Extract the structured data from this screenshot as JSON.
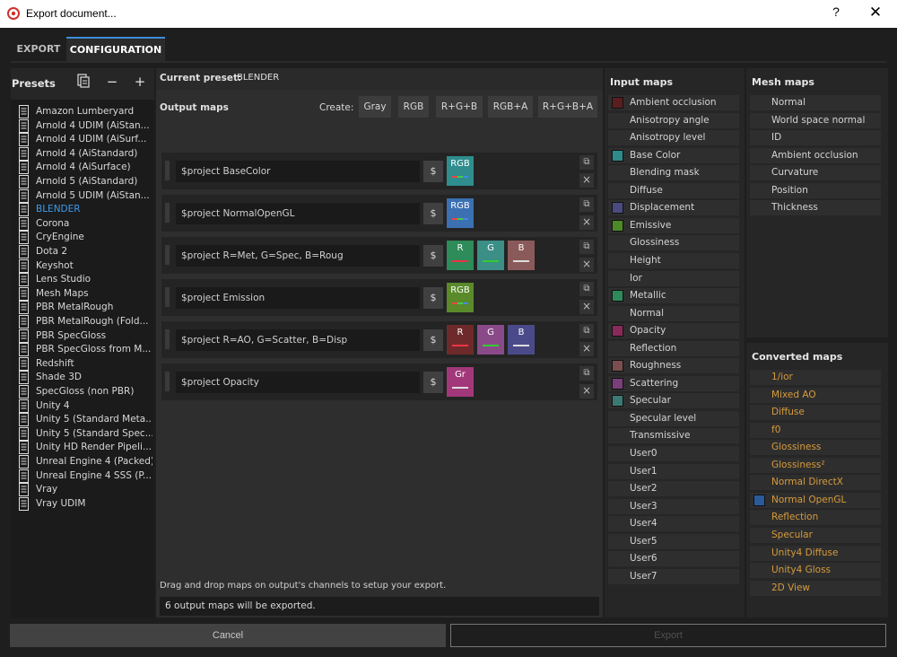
{
  "window": {
    "title": "Export document...",
    "help_label": "?",
    "close_label": "✕"
  },
  "tabs": [
    {
      "label": "EXPORT"
    },
    {
      "label": "CONFIGURATION"
    }
  ],
  "presets": {
    "title": "Presets",
    "icons": [
      "export-preset-icon",
      "remove-icon",
      "add-icon"
    ],
    "minus_label": "−",
    "plus_label": "+",
    "items": [
      {
        "label": "Amazon Lumberyard"
      },
      {
        "label": "Arnold 4  UDIM (AiStan..."
      },
      {
        "label": "Arnold 4  UDIM (AiSurf..."
      },
      {
        "label": "Arnold 4 (AiStandard)"
      },
      {
        "label": "Arnold 4 (AiSurface)"
      },
      {
        "label": "Arnold 5 (AiStandard)"
      },
      {
        "label": "Arnold 5 UDIM (AiStan..."
      },
      {
        "label": "BLENDER"
      },
      {
        "label": "Corona"
      },
      {
        "label": "CryEngine"
      },
      {
        "label": "Dota 2"
      },
      {
        "label": "Keyshot"
      },
      {
        "label": "Lens Studio"
      },
      {
        "label": "Mesh Maps"
      },
      {
        "label": "PBR MetalRough"
      },
      {
        "label": "PBR MetalRough (Fold..."
      },
      {
        "label": "PBR SpecGloss"
      },
      {
        "label": "PBR SpecGloss from M..."
      },
      {
        "label": "Redshift"
      },
      {
        "label": "Shade 3D"
      },
      {
        "label": "SpecGloss (non PBR)"
      },
      {
        "label": "Unity 4"
      },
      {
        "label": "Unity 5 (Standard Meta..."
      },
      {
        "label": "Unity 5 (Standard Spec..."
      },
      {
        "label": "Unity HD Render Pipeli..."
      },
      {
        "label": "Unreal Engine 4 (Packed)"
      },
      {
        "label": "Unreal Engine 4 SSS (P..."
      },
      {
        "label": "Vray"
      },
      {
        "label": "Vray UDIM"
      }
    ],
    "active": "BLENDER"
  },
  "center": {
    "current_preset_label": "Current preset:",
    "current_preset_value": "BLENDER",
    "output_maps_title": "Output maps",
    "create_label": "Create:",
    "create_buttons": [
      "Gray",
      "RGB",
      "R+G+B",
      "RGB+A",
      "R+G+B+A"
    ],
    "output_maps": [
      {
        "name": "$project BaseColor",
        "channels": [
          {
            "label": "RGB",
            "color": "#2f8d8d",
            "bar": "multi"
          }
        ]
      },
      {
        "name": "$project NormalOpenGL",
        "channels": [
          {
            "label": "RGB",
            "color": "#3b70b2",
            "bar": "multi"
          }
        ]
      },
      {
        "name": "$project R=Met, G=Spec, B=Roug",
        "channels": [
          {
            "label": "R",
            "color": "#2e8b5a",
            "bar": "#e34"
          },
          {
            "label": "G",
            "color": "#3b8f87",
            "bar": "#3c3"
          },
          {
            "label": "B",
            "color": "#8a5a5a",
            "bar": "#ddd"
          }
        ]
      },
      {
        "name": "$project Emission",
        "channels": [
          {
            "label": "RGB",
            "color": "#5a8a2a",
            "bar": "multi"
          }
        ]
      },
      {
        "name": "$project R=AO, G=Scatter, B=Disp",
        "channels": [
          {
            "label": "R",
            "color": "#6e2a2a",
            "bar": "#e34"
          },
          {
            "label": "G",
            "color": "#8a4a8a",
            "bar": "#3c3"
          },
          {
            "label": "B",
            "color": "#4a4a8a",
            "bar": "#ddd"
          }
        ]
      },
      {
        "name": "$project Opacity",
        "channels": [
          {
            "label": "Gr",
            "color": "#a2387a",
            "bar": "#ddd"
          }
        ]
      }
    ],
    "dollar_label": "$",
    "hint": "Drag and drop maps on output's channels to setup your export.",
    "status": "6 output maps will be exported."
  },
  "input_maps": {
    "title": "Input maps",
    "items": [
      {
        "label": "Ambient occlusion",
        "color": "#5a1e1e"
      },
      {
        "label": "Anisotropy angle",
        "color": ""
      },
      {
        "label": "Anisotropy level",
        "color": ""
      },
      {
        "label": "Base Color",
        "color": "#2f8a8a"
      },
      {
        "label": "Blending mask",
        "color": ""
      },
      {
        "label": "Diffuse",
        "color": ""
      },
      {
        "label": "Displacement",
        "color": "#4a4a80"
      },
      {
        "label": "Emissive",
        "color": "#4e8a26"
      },
      {
        "label": "Glossiness",
        "color": ""
      },
      {
        "label": "Height",
        "color": ""
      },
      {
        "label": "Ior",
        "color": ""
      },
      {
        "label": "Metallic",
        "color": "#2e8a5a"
      },
      {
        "label": "Normal",
        "color": ""
      },
      {
        "label": "Opacity",
        "color": "#8a2a5a"
      },
      {
        "label": "Reflection",
        "color": ""
      },
      {
        "label": "Roughness",
        "color": "#7a4e4e"
      },
      {
        "label": "Scattering",
        "color": "#7a3e7a"
      },
      {
        "label": "Specular",
        "color": "#3a7a72"
      },
      {
        "label": "Specular level",
        "color": ""
      },
      {
        "label": "Transmissive",
        "color": ""
      },
      {
        "label": "User0",
        "color": ""
      },
      {
        "label": "User1",
        "color": ""
      },
      {
        "label": "User2",
        "color": ""
      },
      {
        "label": "User3",
        "color": ""
      },
      {
        "label": "User4",
        "color": ""
      },
      {
        "label": "User5",
        "color": ""
      },
      {
        "label": "User6",
        "color": ""
      },
      {
        "label": "User7",
        "color": ""
      }
    ]
  },
  "mesh_maps": {
    "title": "Mesh maps",
    "items": [
      {
        "label": "Normal"
      },
      {
        "label": "World space normal"
      },
      {
        "label": "ID"
      },
      {
        "label": "Ambient occlusion"
      },
      {
        "label": "Curvature"
      },
      {
        "label": "Position"
      },
      {
        "label": "Thickness"
      }
    ]
  },
  "converted_maps": {
    "title": "Converted maps",
    "items": [
      {
        "label": "1/ior",
        "color": ""
      },
      {
        "label": "Mixed AO",
        "color": ""
      },
      {
        "label": "Diffuse",
        "color": ""
      },
      {
        "label": "f0",
        "color": ""
      },
      {
        "label": "Glossiness",
        "color": ""
      },
      {
        "label": "Glossiness²",
        "color": ""
      },
      {
        "label": "Normal DirectX",
        "color": ""
      },
      {
        "label": "Normal OpenGL",
        "color": "#2a5a9a"
      },
      {
        "label": "Reflection",
        "color": ""
      },
      {
        "label": "Specular",
        "color": ""
      },
      {
        "label": "Unity4 Diffuse",
        "color": ""
      },
      {
        "label": "Unity4 Gloss",
        "color": ""
      },
      {
        "label": "2D View",
        "color": ""
      }
    ]
  },
  "footer": {
    "cancel_label": "Cancel",
    "export_label": "Export"
  },
  "colors": {
    "accent": "#3d9be9",
    "converted_text": "#d69b3c",
    "tab_indicator": "#3c8fd6"
  }
}
